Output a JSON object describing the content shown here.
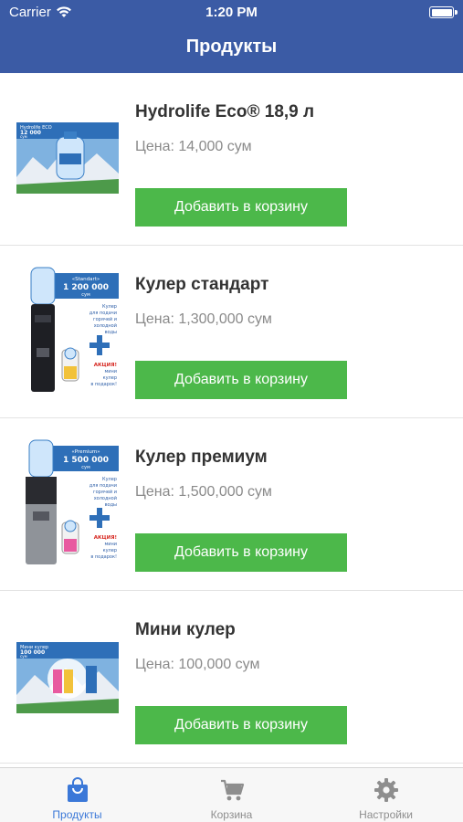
{
  "status_bar": {
    "carrier": "Carrier",
    "time": "1:20 PM"
  },
  "nav": {
    "title": "Продукты"
  },
  "products": [
    {
      "name": "Hydrolife Eco® 18,9 л",
      "price_label": "Цена:",
      "price_value": "14,000 сум",
      "button": "Добавить в корзину",
      "image_text": [
        "Hydrolife ECO",
        "12 000",
        "сум"
      ]
    },
    {
      "name": "Кулер стандарт",
      "price_label": "Цена:",
      "price_value": "1,300,000 сум",
      "button": "Добавить в корзину",
      "image_text": [
        "«Standart»",
        "1 200 000",
        "сум",
        "Кулер",
        "для подачи",
        "горячей и",
        "холодной",
        "воды",
        "АКЦИЯ!",
        "мини",
        "кулер",
        "в подарок!"
      ]
    },
    {
      "name": "Кулер премиум",
      "price_label": "Цена:",
      "price_value": "1,500,000 сум",
      "button": "Добавить в корзину",
      "image_text": [
        "«Premium»",
        "1 500 000",
        "сум",
        "Кулер",
        "для подачи",
        "горячей и",
        "холодной",
        "воды",
        "АКЦИЯ!",
        "мини",
        "кулер",
        "в подарок!"
      ]
    },
    {
      "name": "Мини кулер",
      "price_label": "Цена:",
      "price_value": "100,000 сум",
      "button": "Добавить в корзину",
      "image_text": [
        "Мини кулер",
        "100 000",
        "сум"
      ]
    }
  ],
  "tabs": [
    {
      "label": "Продукты",
      "icon": "shopping-bag-icon",
      "active": true
    },
    {
      "label": "Корзина",
      "icon": "cart-icon",
      "active": false
    },
    {
      "label": "Настройки",
      "icon": "gear-icon",
      "active": false
    }
  ],
  "colors": {
    "nav_bar": "#3b5ba5",
    "button": "#4cb84a",
    "tab_active": "#3b78d8",
    "tab_inactive": "#8e8e8e"
  }
}
